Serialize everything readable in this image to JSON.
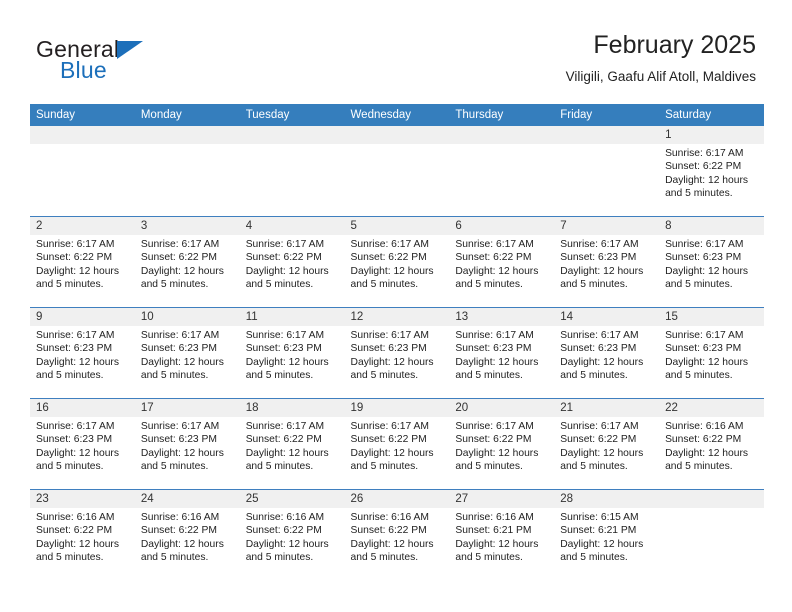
{
  "brand": {
    "word_one": "General",
    "word_two": "Blue",
    "mark": "triangle-logo"
  },
  "header": {
    "title": "February 2025",
    "subtitle": "Viligili, Gaafu Alif Atoll, Maldives"
  },
  "colors": {
    "header_blue": "#357ebd",
    "row_divider": "#3f7fbf",
    "daynum_band": "#f0f0f0",
    "brand_blue": "#1c6fba",
    "text": "#222222"
  },
  "weekdays": [
    "Sunday",
    "Monday",
    "Tuesday",
    "Wednesday",
    "Thursday",
    "Friday",
    "Saturday"
  ],
  "labels": {
    "sunrise_prefix": "Sunrise: ",
    "sunset_prefix": "Sunset: ",
    "daylight_prefix": "Daylight: "
  },
  "weeks": [
    [
      {
        "day": "",
        "empty": true
      },
      {
        "day": "",
        "empty": true
      },
      {
        "day": "",
        "empty": true
      },
      {
        "day": "",
        "empty": true
      },
      {
        "day": "",
        "empty": true
      },
      {
        "day": "",
        "empty": true
      },
      {
        "day": "1",
        "sunrise": "Sunrise: 6:17 AM",
        "sunset": "Sunset: 6:22 PM",
        "daylight": "Daylight: 12 hours and 5 minutes."
      }
    ],
    [
      {
        "day": "2",
        "sunrise": "Sunrise: 6:17 AM",
        "sunset": "Sunset: 6:22 PM",
        "daylight": "Daylight: 12 hours and 5 minutes."
      },
      {
        "day": "3",
        "sunrise": "Sunrise: 6:17 AM",
        "sunset": "Sunset: 6:22 PM",
        "daylight": "Daylight: 12 hours and 5 minutes."
      },
      {
        "day": "4",
        "sunrise": "Sunrise: 6:17 AM",
        "sunset": "Sunset: 6:22 PM",
        "daylight": "Daylight: 12 hours and 5 minutes."
      },
      {
        "day": "5",
        "sunrise": "Sunrise: 6:17 AM",
        "sunset": "Sunset: 6:22 PM",
        "daylight": "Daylight: 12 hours and 5 minutes."
      },
      {
        "day": "6",
        "sunrise": "Sunrise: 6:17 AM",
        "sunset": "Sunset: 6:22 PM",
        "daylight": "Daylight: 12 hours and 5 minutes."
      },
      {
        "day": "7",
        "sunrise": "Sunrise: 6:17 AM",
        "sunset": "Sunset: 6:23 PM",
        "daylight": "Daylight: 12 hours and 5 minutes."
      },
      {
        "day": "8",
        "sunrise": "Sunrise: 6:17 AM",
        "sunset": "Sunset: 6:23 PM",
        "daylight": "Daylight: 12 hours and 5 minutes."
      }
    ],
    [
      {
        "day": "9",
        "sunrise": "Sunrise: 6:17 AM",
        "sunset": "Sunset: 6:23 PM",
        "daylight": "Daylight: 12 hours and 5 minutes."
      },
      {
        "day": "10",
        "sunrise": "Sunrise: 6:17 AM",
        "sunset": "Sunset: 6:23 PM",
        "daylight": "Daylight: 12 hours and 5 minutes."
      },
      {
        "day": "11",
        "sunrise": "Sunrise: 6:17 AM",
        "sunset": "Sunset: 6:23 PM",
        "daylight": "Daylight: 12 hours and 5 minutes."
      },
      {
        "day": "12",
        "sunrise": "Sunrise: 6:17 AM",
        "sunset": "Sunset: 6:23 PM",
        "daylight": "Daylight: 12 hours and 5 minutes."
      },
      {
        "day": "13",
        "sunrise": "Sunrise: 6:17 AM",
        "sunset": "Sunset: 6:23 PM",
        "daylight": "Daylight: 12 hours and 5 minutes."
      },
      {
        "day": "14",
        "sunrise": "Sunrise: 6:17 AM",
        "sunset": "Sunset: 6:23 PM",
        "daylight": "Daylight: 12 hours and 5 minutes."
      },
      {
        "day": "15",
        "sunrise": "Sunrise: 6:17 AM",
        "sunset": "Sunset: 6:23 PM",
        "daylight": "Daylight: 12 hours and 5 minutes."
      }
    ],
    [
      {
        "day": "16",
        "sunrise": "Sunrise: 6:17 AM",
        "sunset": "Sunset: 6:23 PM",
        "daylight": "Daylight: 12 hours and 5 minutes."
      },
      {
        "day": "17",
        "sunrise": "Sunrise: 6:17 AM",
        "sunset": "Sunset: 6:23 PM",
        "daylight": "Daylight: 12 hours and 5 minutes."
      },
      {
        "day": "18",
        "sunrise": "Sunrise: 6:17 AM",
        "sunset": "Sunset: 6:22 PM",
        "daylight": "Daylight: 12 hours and 5 minutes."
      },
      {
        "day": "19",
        "sunrise": "Sunrise: 6:17 AM",
        "sunset": "Sunset: 6:22 PM",
        "daylight": "Daylight: 12 hours and 5 minutes."
      },
      {
        "day": "20",
        "sunrise": "Sunrise: 6:17 AM",
        "sunset": "Sunset: 6:22 PM",
        "daylight": "Daylight: 12 hours and 5 minutes."
      },
      {
        "day": "21",
        "sunrise": "Sunrise: 6:17 AM",
        "sunset": "Sunset: 6:22 PM",
        "daylight": "Daylight: 12 hours and 5 minutes."
      },
      {
        "day": "22",
        "sunrise": "Sunrise: 6:16 AM",
        "sunset": "Sunset: 6:22 PM",
        "daylight": "Daylight: 12 hours and 5 minutes."
      }
    ],
    [
      {
        "day": "23",
        "sunrise": "Sunrise: 6:16 AM",
        "sunset": "Sunset: 6:22 PM",
        "daylight": "Daylight: 12 hours and 5 minutes."
      },
      {
        "day": "24",
        "sunrise": "Sunrise: 6:16 AM",
        "sunset": "Sunset: 6:22 PM",
        "daylight": "Daylight: 12 hours and 5 minutes."
      },
      {
        "day": "25",
        "sunrise": "Sunrise: 6:16 AM",
        "sunset": "Sunset: 6:22 PM",
        "daylight": "Daylight: 12 hours and 5 minutes."
      },
      {
        "day": "26",
        "sunrise": "Sunrise: 6:16 AM",
        "sunset": "Sunset: 6:22 PM",
        "daylight": "Daylight: 12 hours and 5 minutes."
      },
      {
        "day": "27",
        "sunrise": "Sunrise: 6:16 AM",
        "sunset": "Sunset: 6:21 PM",
        "daylight": "Daylight: 12 hours and 5 minutes."
      },
      {
        "day": "28",
        "sunrise": "Sunrise: 6:15 AM",
        "sunset": "Sunset: 6:21 PM",
        "daylight": "Daylight: 12 hours and 5 minutes."
      },
      {
        "day": "",
        "empty": true
      }
    ]
  ]
}
